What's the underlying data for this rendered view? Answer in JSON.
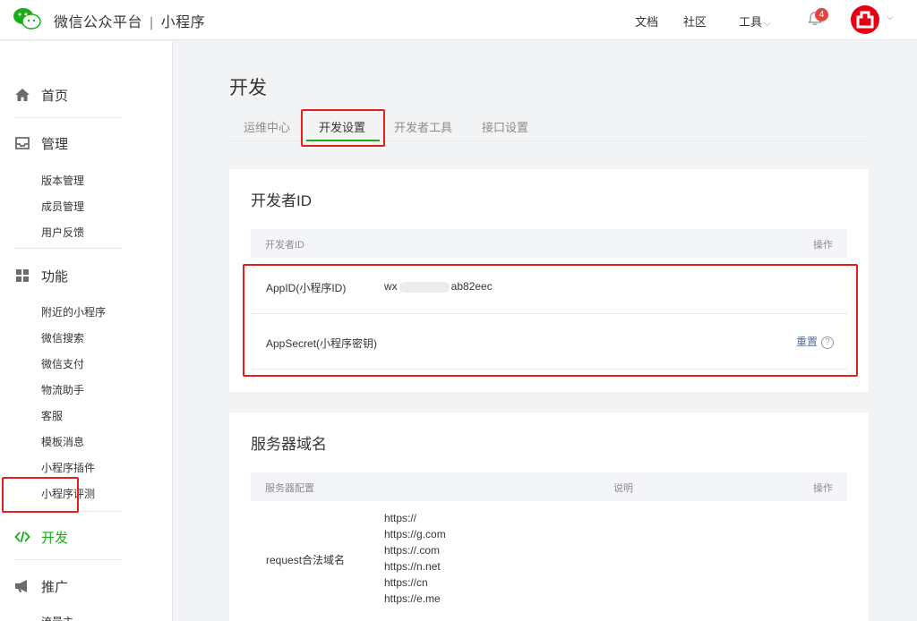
{
  "topbar": {
    "brand": "微信公众平台",
    "separator": "|",
    "product": "小程序",
    "links": [
      "文档",
      "社区",
      "工具"
    ],
    "tools_caret": "⌵",
    "notification_count": "4"
  },
  "colors": {
    "accent_green": "#1aad19",
    "highlight_red": "#e3211a",
    "avatar_red": "#e60012"
  },
  "sidebar": {
    "home": "首页",
    "manage": {
      "title": "管理",
      "items": [
        "版本管理",
        "成员管理",
        "用户反馈"
      ]
    },
    "features": {
      "title": "功能",
      "items": [
        "附近的小程序",
        "微信搜索",
        "微信支付",
        "物流助手",
        "客服",
        "模板消息",
        "小程序插件",
        "小程序评测"
      ]
    },
    "develop": "开发",
    "promote": "推广",
    "traffic": "流量主"
  },
  "main": {
    "title": "开发",
    "tabs": [
      "运维中心",
      "开发设置",
      "开发者工具",
      "接口设置"
    ],
    "active_tab": "开发设置",
    "developer_id": {
      "title": "开发者ID",
      "header_left": "开发者ID",
      "header_right": "操作",
      "rows": [
        {
          "label": "AppID(小程序ID)",
          "value_prefix": "wx",
          "value_suffix": "ab82eec"
        },
        {
          "label": "AppSecret(小程序密钥)",
          "action": "重置",
          "help": "?"
        }
      ]
    },
    "server_domain": {
      "title": "服务器域名",
      "header": [
        "服务器配置",
        "说明",
        "操作"
      ],
      "row_label": "request合法域名",
      "domains": [
        "https://",
        "https://g.com",
        "https://.com",
        "https://n.net",
        "https://cn",
        "https://e.me"
      ]
    }
  }
}
